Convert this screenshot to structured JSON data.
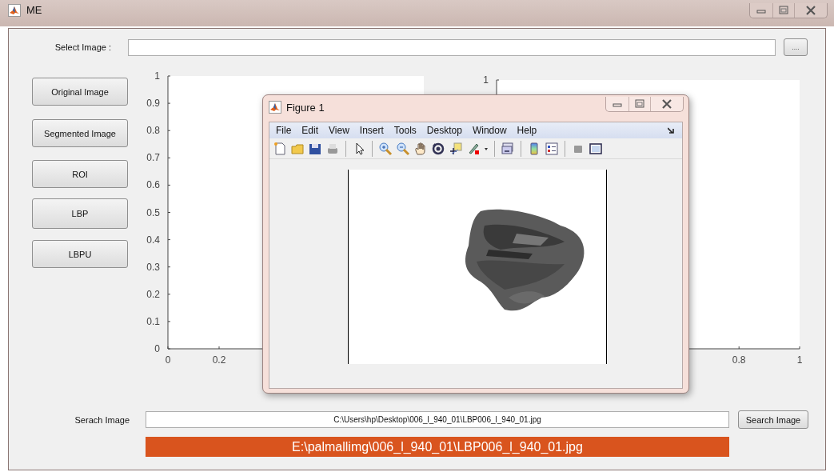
{
  "window": {
    "title": "ME"
  },
  "select_image": {
    "label": "Select Image :",
    "browse_button": "...."
  },
  "buttons": [
    "Original Image",
    "Segmented Image",
    "ROI",
    "LBP",
    "LBPU"
  ],
  "axes": [
    {
      "y_tick_labels": [
        "1",
        "0.9",
        "0.8",
        "0.7",
        "0.6",
        "0.5",
        "0.4",
        "0.3",
        "0.2",
        "0.1",
        "0"
      ],
      "x_tick_labels": [
        "0",
        "0.2"
      ]
    },
    {
      "y_tick_labels": [
        "1"
      ],
      "x_tick_labels": [
        "0.8",
        "1"
      ]
    }
  ],
  "figure_window": {
    "title": "Figure 1",
    "menu": [
      "File",
      "Edit",
      "View",
      "Insert",
      "Tools",
      "Desktop",
      "Window",
      "Help"
    ]
  },
  "search": {
    "label": "Serach Image",
    "value": "C:\\Users\\hp\\Desktop\\006_l_940_01\\LBP006_l_940_01.jpg",
    "button": "Search Image"
  },
  "result": "E:\\palmallimg\\006_l_940_01\\LBP006_l_940_01.jpg"
}
